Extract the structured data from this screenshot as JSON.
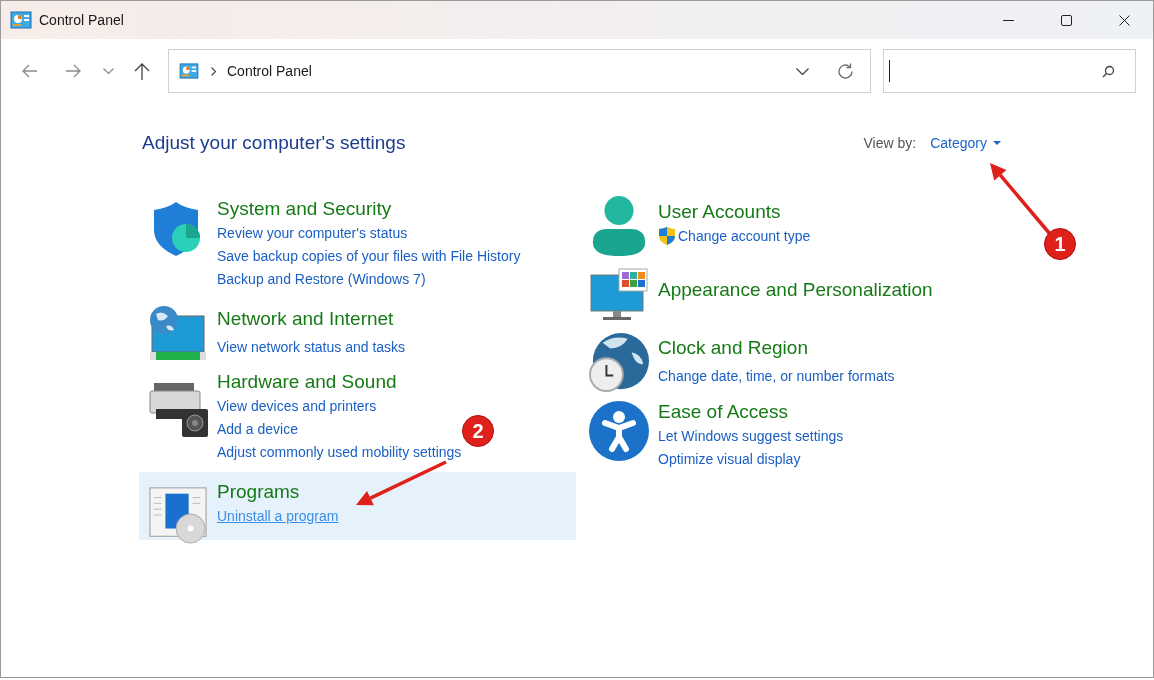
{
  "window": {
    "title": "Control Panel"
  },
  "address_bar": {
    "path": [
      "Control Panel"
    ]
  },
  "heading": "Adjust your computer's settings",
  "view_by": {
    "label": "View by:",
    "value": "Category"
  },
  "columns": [
    {
      "categories": [
        {
          "kind": "security",
          "title": "System and Security",
          "hovered": false,
          "links": [
            {
              "text": "Review your computer's status",
              "shield": false,
              "hovered": false
            },
            {
              "text": "Save backup copies of your files with File History",
              "shield": false,
              "hovered": false
            },
            {
              "text": "Backup and Restore (Windows 7)",
              "shield": false,
              "hovered": false
            }
          ]
        },
        {
          "kind": "network",
          "title": "Network and Internet",
          "hovered": false,
          "links": [
            {
              "text": "View network status and tasks",
              "shield": false,
              "hovered": false
            }
          ]
        },
        {
          "kind": "hardware",
          "title": "Hardware and Sound",
          "hovered": false,
          "links": [
            {
              "text": "View devices and printers",
              "shield": false,
              "hovered": false
            },
            {
              "text": "Add a device",
              "shield": false,
              "hovered": false
            },
            {
              "text": "Adjust commonly used mobility settings",
              "shield": false,
              "hovered": false
            }
          ]
        },
        {
          "kind": "programs",
          "title": "Programs",
          "hovered": true,
          "links": [
            {
              "text": "Uninstall a program",
              "shield": false,
              "hovered": true
            }
          ]
        }
      ]
    },
    {
      "categories": [
        {
          "kind": "user",
          "title": "User Accounts",
          "hovered": false,
          "links": [
            {
              "text": "Change account type",
              "shield": true,
              "hovered": false
            }
          ]
        },
        {
          "kind": "appearance",
          "title": "Appearance and Personalization",
          "hovered": false
        },
        {
          "kind": "clock",
          "title": "Clock and Region",
          "hovered": false,
          "links": [
            {
              "text": "Change date, time, or number formats",
              "shield": false,
              "hovered": false
            }
          ]
        },
        {
          "kind": "access",
          "title": "Ease of Access",
          "hovered": false,
          "links": [
            {
              "text": "Let Windows suggest settings",
              "shield": false,
              "hovered": false
            },
            {
              "text": "Optimize visual display",
              "shield": false,
              "hovered": false
            }
          ]
        }
      ]
    }
  ],
  "annotations": [
    {
      "label": "1"
    },
    {
      "label": "2"
    }
  ]
}
